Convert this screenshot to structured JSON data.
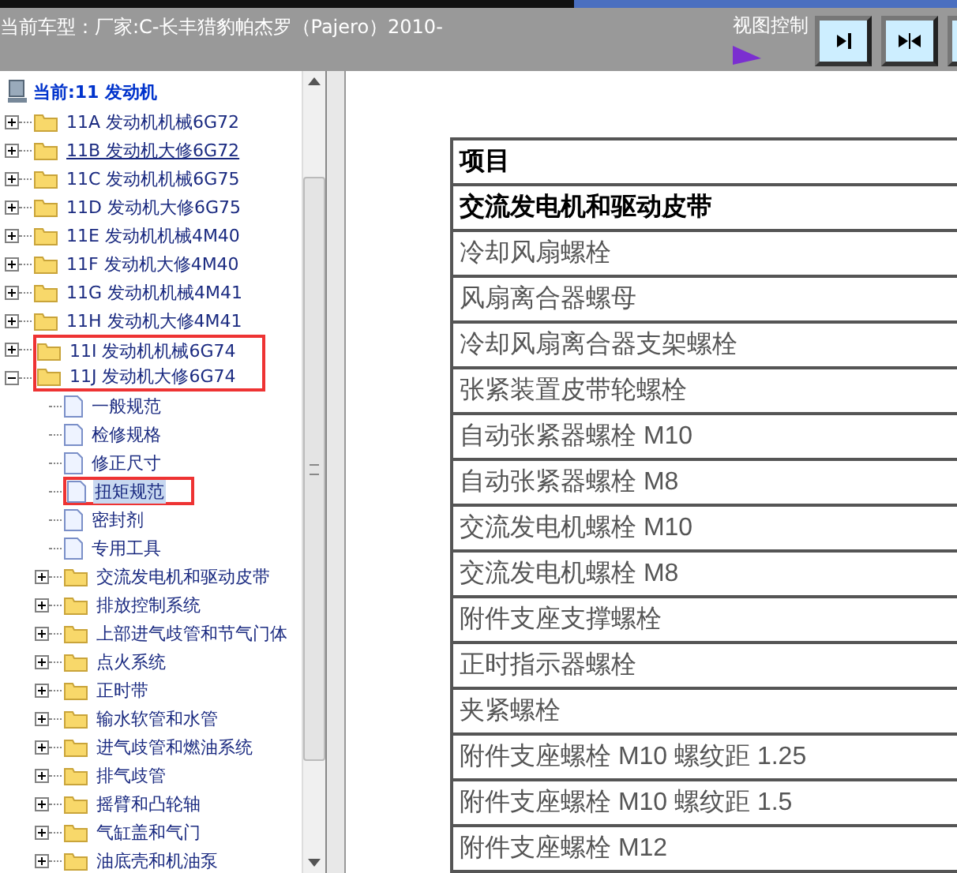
{
  "header": {
    "title": "当前车型：厂家:C-长丰猎豹帕杰罗（Pajero）2010-",
    "view_control": {
      "label": "视图控制",
      "buttons": [
        {
          "kind": "right",
          "pressed": false
        },
        {
          "kind": "both",
          "pressed": false
        },
        {
          "pressed": false
        }
      ]
    }
  },
  "tree": {
    "root": {
      "label": "当前:11 发动机",
      "children": [
        {
          "kind": "folder",
          "label": "11A 发动机机械6G72",
          "expanded": false,
          "hovered": false,
          "marked": false
        },
        {
          "kind": "folder",
          "label": "11B 发动机大修6G72",
          "expanded": false,
          "hovered": true,
          "marked": false
        },
        {
          "kind": "folder",
          "label": "11C 发动机机械6G75",
          "expanded": false,
          "hovered": false,
          "marked": false
        },
        {
          "kind": "folder",
          "label": "11D 发动机大修6G75",
          "expanded": false,
          "hovered": false,
          "marked": false
        },
        {
          "kind": "folder",
          "label": "11E 发动机机械4M40",
          "expanded": false,
          "hovered": false,
          "marked": false
        },
        {
          "kind": "folder",
          "label": "11F 发动机大修4M40",
          "expanded": false,
          "hovered": false,
          "marked": false
        },
        {
          "kind": "folder",
          "label": "11G 发动机机械4M41",
          "expanded": false,
          "hovered": false,
          "marked": false
        },
        {
          "kind": "folder",
          "label": "11H 发动机大修4M41",
          "expanded": false,
          "hovered": false,
          "marked": false
        },
        {
          "kind": "folder",
          "label": "11I 发动机机械6G74",
          "expanded": false,
          "hovered": false,
          "marked": true
        },
        {
          "kind": "folder",
          "label": "11J 发动机大修6G74",
          "expanded": true,
          "hovered": false,
          "marked": true,
          "children": [
            {
              "kind": "page",
              "label": "一般规范",
              "selected": false,
              "marked": false
            },
            {
              "kind": "page",
              "label": "检修规格",
              "selected": false,
              "marked": false
            },
            {
              "kind": "page",
              "label": "修正尺寸",
              "selected": false,
              "marked": false
            },
            {
              "kind": "page",
              "label": "扭矩规范",
              "selected": true,
              "marked": true
            },
            {
              "kind": "page",
              "label": "密封剂",
              "selected": false,
              "marked": false
            },
            {
              "kind": "page",
              "label": "专用工具",
              "selected": false,
              "marked": false
            },
            {
              "kind": "folder",
              "label": "交流发电机和驱动皮带",
              "expanded": false,
              "marked": false
            },
            {
              "kind": "folder",
              "label": "排放控制系统",
              "expanded": false,
              "marked": false
            },
            {
              "kind": "folder",
              "label": "上部进气歧管和节气门体",
              "expanded": false,
              "marked": false
            },
            {
              "kind": "folder",
              "label": "点火系统",
              "expanded": false,
              "marked": false
            },
            {
              "kind": "folder",
              "label": "正时带",
              "expanded": false,
              "marked": false
            },
            {
              "kind": "folder",
              "label": "输水软管和水管",
              "expanded": false,
              "marked": false
            },
            {
              "kind": "folder",
              "label": "进气歧管和燃油系统",
              "expanded": false,
              "marked": false
            },
            {
              "kind": "folder",
              "label": "排气歧管",
              "expanded": false,
              "marked": false
            },
            {
              "kind": "folder",
              "label": "摇臂和凸轮轴",
              "expanded": false,
              "marked": false
            },
            {
              "kind": "folder",
              "label": "气缸盖和气门",
              "expanded": false,
              "marked": false
            },
            {
              "kind": "folder",
              "label": "油底壳和机油泵",
              "expanded": false,
              "marked": false
            }
          ]
        }
      ]
    }
  },
  "table": {
    "columns": [
      "项目"
    ],
    "rows": [
      {
        "kind": "section",
        "cells": [
          "交流发电机和驱动皮带"
        ]
      },
      {
        "kind": "item",
        "cells": [
          "冷却风扇螺栓"
        ]
      },
      {
        "kind": "item",
        "cells": [
          "风扇离合器螺母"
        ]
      },
      {
        "kind": "item",
        "cells": [
          "冷却风扇离合器支架螺栓"
        ]
      },
      {
        "kind": "item",
        "cells": [
          "张紧装置皮带轮螺栓"
        ]
      },
      {
        "kind": "item",
        "cells": [
          "自动张紧器螺栓 M10"
        ]
      },
      {
        "kind": "item",
        "cells": [
          "自动张紧器螺栓 M8"
        ]
      },
      {
        "kind": "item",
        "cells": [
          "交流发电机螺栓 M10"
        ]
      },
      {
        "kind": "item",
        "cells": [
          "交流发电机螺栓 M8"
        ]
      },
      {
        "kind": "item",
        "cells": [
          "附件支座支撑螺栓"
        ]
      },
      {
        "kind": "item",
        "cells": [
          "正时指示器螺栓"
        ]
      },
      {
        "kind": "item",
        "cells": [
          "夹紧螺栓"
        ]
      },
      {
        "kind": "item",
        "cells": [
          "附件支座螺栓 M10 螺纹距 1.25"
        ]
      },
      {
        "kind": "item",
        "cells": [
          "附件支座螺栓 M10 螺纹距 1.5"
        ]
      },
      {
        "kind": "item",
        "cells": [
          "附件支座螺栓 M12"
        ]
      }
    ]
  }
}
